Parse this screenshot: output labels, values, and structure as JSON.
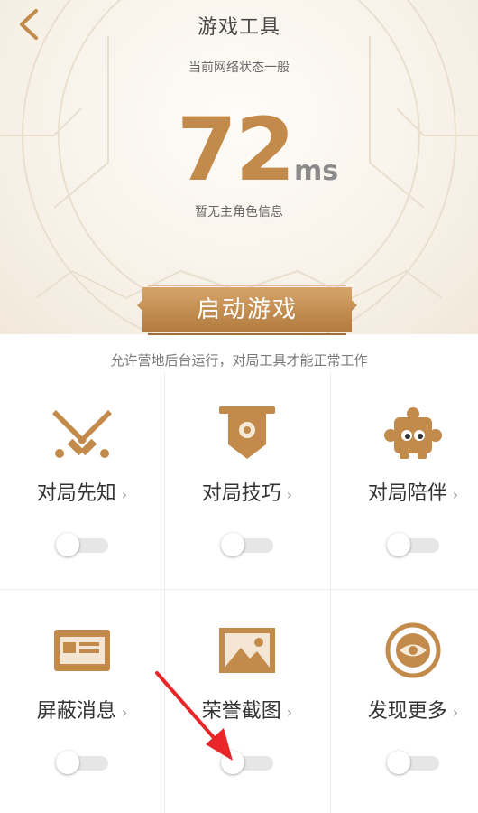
{
  "header": {
    "title": "游戏工具",
    "network_status": "当前网络状态一般",
    "ping_value": "72",
    "ping_unit": "ms",
    "role_info": "暂无主角色信息"
  },
  "launch": {
    "label": "启动游戏",
    "hint": "允许营地后台运行，对局工具才能正常工作"
  },
  "tools": [
    {
      "label": "对局先知",
      "icon": "crossed-swords-icon",
      "enabled": false
    },
    {
      "label": "对局技巧",
      "icon": "banner-shield-icon",
      "enabled": false
    },
    {
      "label": "对局陪伴",
      "icon": "puzzle-robot-icon",
      "enabled": false
    },
    {
      "label": "屏蔽消息",
      "icon": "message-card-icon",
      "enabled": false
    },
    {
      "label": "荣誉截图",
      "icon": "image-icon",
      "enabled": false
    },
    {
      "label": "发现更多",
      "icon": "eye-target-icon",
      "enabled": false
    }
  ],
  "colors": {
    "accent": "#c28a4b",
    "accent_dark": "#b27a3d",
    "annotation_arrow": "#e8262a"
  }
}
